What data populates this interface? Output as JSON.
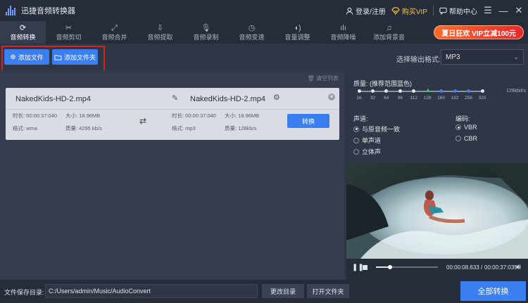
{
  "app": {
    "title": "迅捷音频转换器"
  },
  "titlebar": {
    "login": "登录/注册",
    "buy_vip": "购买VIP",
    "help": "帮助中心"
  },
  "nav": [
    {
      "label": "音频转换",
      "icon": "refresh-icon"
    },
    {
      "label": "音频剪切",
      "icon": "scissors-icon"
    },
    {
      "label": "音频合并",
      "icon": "merge-icon"
    },
    {
      "label": "音频提取",
      "icon": "extract-icon"
    },
    {
      "label": "音频录制",
      "icon": "microphone-icon"
    },
    {
      "label": "音频变速",
      "icon": "speedometer-icon"
    },
    {
      "label": "音量调整",
      "icon": "volume-icon"
    },
    {
      "label": "音频降噪",
      "icon": "waveform-icon"
    },
    {
      "label": "添加背景音",
      "icon": "music-note-icon"
    }
  ],
  "promo": "夏日狂欢 VIP立减100元",
  "toolbar": {
    "add_file": "添加文件",
    "add_folder": "添加文件夹",
    "output_format_label": "选择输出格式:",
    "output_format": "MP3"
  },
  "list": {
    "clear": "清空列表",
    "file": {
      "source_name": "NakedKids-HD-2.mp4",
      "target_name": "NakedKids-HD-2.mp4",
      "src_duration": "时长: 00:00:37:040",
      "src_size": "大小: 18.96MB",
      "src_format": "格式: wma",
      "src_quality": "质量: 4295 kb/s",
      "dst_duration": "时长: 00:00:37:040",
      "dst_size": "大小: 18.96MB",
      "dst_format": "格式: mp3",
      "dst_quality": "质量: 128kb/s",
      "convert": "转换"
    }
  },
  "settings": {
    "quality_label": "质量: (推荐范围蓝色)",
    "quality_ticks": [
      "16",
      "32",
      "64",
      "96",
      "112",
      "128",
      "160",
      "192",
      "256",
      "320"
    ],
    "selected_index": 5,
    "kbit": "128kbit/s",
    "channel_label": "声道:",
    "channels": [
      "与原音频一致",
      "单声道",
      "立体声"
    ],
    "channel_selected": 0,
    "encoding_label": "编码:",
    "encodings": [
      "VBR",
      "CBR"
    ],
    "encoding_selected": 0
  },
  "player": {
    "current": "00:00:08.633",
    "total": "00:00:37:035",
    "progress": 0.23
  },
  "bottom": {
    "save_label": "文件保存目录:",
    "save_path": "C:/Users/admin/Music/AudioConvert",
    "change_dir": "更改目录",
    "open_folder": "打开文件夹",
    "convert_all": "全部转换"
  }
}
